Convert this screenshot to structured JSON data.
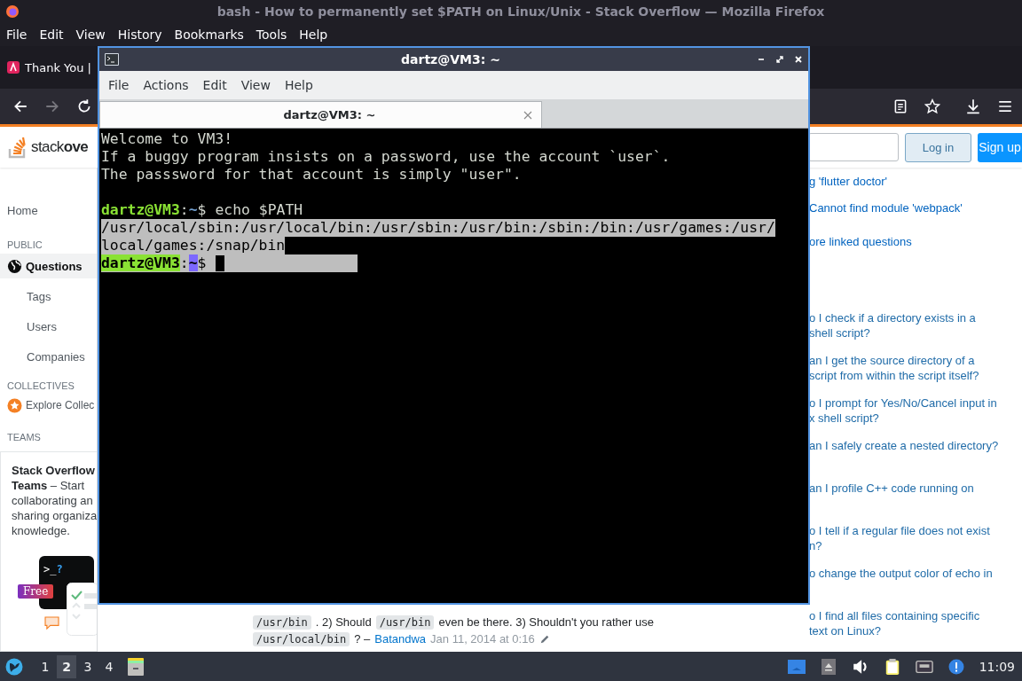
{
  "browser": {
    "title": "bash - How to permanently set $PATH on Linux/Unix - Stack Overflow — Mozilla Firefox",
    "menu": [
      "File",
      "Edit",
      "View",
      "History",
      "Bookmarks",
      "Tools",
      "Help"
    ],
    "tabs": [
      {
        "label": "Thank You |",
        "selected": false
      }
    ]
  },
  "site": {
    "logo": "stack**ove**",
    "login": "Log in",
    "signup": "Sign up",
    "sidebar": [
      {
        "kind": "link",
        "label": "Home",
        "selected": false
      },
      {
        "kind": "heading",
        "label": "PUBLIC"
      },
      {
        "kind": "primary",
        "label": "Questions",
        "selected": true
      },
      {
        "kind": "sub",
        "label": "Tags",
        "selected": false
      },
      {
        "kind": "sub",
        "label": "Users",
        "selected": false
      },
      {
        "kind": "sub",
        "label": "Companies",
        "selected": false
      },
      {
        "kind": "heading",
        "label": "COLLECTIVES"
      },
      {
        "kind": "collective",
        "label": "Explore Collec",
        "selected": false
      },
      {
        "kind": "heading",
        "label": "TEAMS"
      }
    ],
    "teams": {
      "text": "**Stack Overflow\nTeams** – Start\ncollaborating an\nsharing organiza\nknowledge.",
      "glyph": ">_",
      "glyph_mark": "?",
      "badge": "Free"
    },
    "comment": {
      "lines": [
        [
          {
            "kind": "code",
            "text": "/usr/bin"
          },
          {
            "kind": "text",
            "text": ". 2) Should"
          },
          {
            "kind": "code",
            "text": "/usr/bin"
          },
          {
            "kind": "text",
            "text": "even be there. 3) Shouldn't you rather use"
          }
        ],
        [
          {
            "kind": "code",
            "text": "/usr/local/bin"
          },
          {
            "kind": "text",
            "text": "? –"
          }
        ]
      ],
      "author": "Batandwa",
      "date": "Jan 11, 2014 at 0:16"
    },
    "questions": [
      {
        "lines": [
          "g 'flutter doctor'"
        ],
        "kind": "linked"
      },
      {
        "lines": [
          "Cannot find module 'webpack'"
        ],
        "kind": "linked"
      },
      {
        "lines": [
          "ore linked questions"
        ],
        "kind": "more"
      },
      {
        "lines": [
          "o I check if a directory exists in a",
          "shell script?"
        ],
        "kind": "related"
      },
      {
        "lines": [
          "an I get the source directory of a",
          "script from within the script itself?"
        ],
        "kind": "related"
      },
      {
        "lines": [
          "o I prompt for Yes/No/Cancel input in",
          "x shell script?"
        ],
        "kind": "related"
      },
      {
        "lines": [
          "an I safely create a nested directory?"
        ],
        "kind": "related"
      },
      {
        "lines": [
          "an I profile C++ code running on"
        ],
        "kind": "related"
      },
      {
        "lines": [
          "o I tell if a regular file does not exist",
          "n?"
        ],
        "kind": "related"
      },
      {
        "lines": [
          "o change the output color of echo in"
        ],
        "kind": "related"
      },
      {
        "lines": [
          "o I find all files containing specific",
          "text on Linux?"
        ],
        "kind": "related"
      }
    ]
  },
  "terminal": {
    "title": "dartz@VM3: ~",
    "menu": [
      "File",
      "Actions",
      "Edit",
      "View",
      "Help"
    ],
    "tabs": [
      {
        "label": "dartz@VM3: ~",
        "selected": true
      }
    ],
    "lines": [
      {
        "kind": "text",
        "text": "Welcome to VM3!",
        "selected": false
      },
      {
        "kind": "text",
        "text": "If a buggy program insists on a password, use the account `user`.",
        "selected": false
      },
      {
        "kind": "text",
        "text": "The passsword for that account is simply \"user\".",
        "selected": false
      },
      {
        "kind": "blank"
      },
      {
        "kind": "prompt",
        "user": "dartz@VM3",
        "sep": ":",
        "cwd": "~",
        "symbol": "$",
        "command": "echo $PATH",
        "selected": false,
        "cursor": false
      },
      {
        "kind": "text",
        "text": "/usr/local/sbin:/usr/local/bin:/usr/sbin:/usr/bin:/sbin:/bin:/usr/games:/usr/",
        "selected": true
      },
      {
        "kind": "text",
        "text": "local/games:/snap/bin",
        "selected": true
      },
      {
        "kind": "prompt",
        "user": "dartz@VM3",
        "sep": ":",
        "cwd": "~",
        "symbol": "$",
        "selected": true,
        "cursor": true
      }
    ]
  },
  "taskbar": {
    "workspaces": [
      {
        "label": "1",
        "selected": false
      },
      {
        "label": "2",
        "selected": true
      },
      {
        "label": "3",
        "selected": false
      },
      {
        "label": "4",
        "selected": false
      }
    ],
    "clock": "11:09"
  }
}
